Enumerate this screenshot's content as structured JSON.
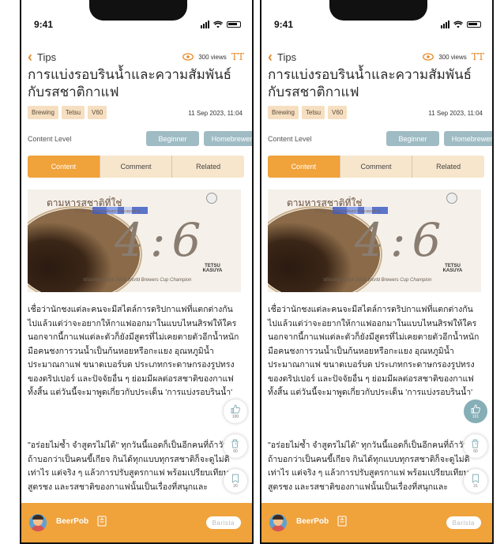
{
  "screens": [
    {
      "status": {
        "time": "9:41"
      },
      "header": {
        "back_label": "Tips",
        "views": "300 views",
        "text_size_icon": "TT"
      },
      "article": {
        "title": "การแบ่งรอบรินน้ำและความสัมพันธ์กับรสชาติกาแฟ",
        "tags": [
          "Brewing",
          "Tetsu",
          "V60"
        ],
        "date": "11 Sep 2023, 11:04",
        "content_level_label": "Content Level",
        "levels": [
          "Beginner",
          "Homebrewer"
        ],
        "tabs": [
          "Content",
          "Comment",
          "Related"
        ],
        "cover": {
          "line1": "ตามหารสชาติที่ใช่",
          "line2": "ปรับสูตรตามความต้องการของคุณด้วย",
          "ratio": "4:6",
          "author": "TETSU KASUYA",
          "footer": "Winning recipe 2016 World Brewers Cup Champion"
        },
        "paragraph1": "เชื่อว่านักชงแต่ละคนจะมีสไตล์การดริปกาแฟที่แตกต่างกันไปแล้วแต่ว่าจะอยากให้กาแฟออกมาในแบบไหนสิรฟให้ใครนอกจากนี้กาแฟแต่ละตัวก็ยังมีสูตรที่ไม่เคยตายตัวอีกน้ำหนักมือคนชงการวนน้ำเป็นก้นหอยหรือกะแยง อุณหภูมิน้ำประมาณกาแฟ ขนาดเบอร์บด ประเภทกระดาษกรองรูปทรงของดริปเปอร์ และปัจจัยอื่น ๆ ย่อมมีผลต่อรสชาติของกาแฟทั้งสิ้น แต่วันนี้จะมาพูดเกี่ยวกับประเด็น 'การแบ่งรอบรินน้ำ'",
        "paragraph2": "\"อร่อยไม่ซ้ำ จำสูตรไม่ได้\" ทุกวันนี้แอดก็เป็นอีกคนที่ถ้าวันนี้ ถ้าบอกว่าเป็นคนขี้เกียจ กินได้ทุกแบบทุกรสชาติก็จะดูไม่ดีเท่าไร แต่จริง ๆ แล้วการปรับสูตรกาแฟ พร้อมเปรียบเทียบสูตรชง และรสชาติของกาแฟนั้นเป็นเรื่องที่สนุกและ"
      },
      "actions": {
        "likes": "100",
        "cups": "60",
        "saves": "20",
        "like_active": false
      },
      "footer": {
        "author": "BeerPob",
        "role": "Barista"
      }
    },
    {
      "status": {
        "time": "9:41"
      },
      "header": {
        "back_label": "Tips",
        "views": "300 views",
        "text_size_icon": "TT"
      },
      "article": {
        "title": "การแบ่งรอบรินน้ำและความสัมพันธ์กับรสชาติกาแฟ",
        "tags": [
          "Brewing",
          "Tetsu",
          "V60"
        ],
        "date": "11 Sep 2023, 11:04",
        "content_level_label": "Content Level",
        "levels": [
          "Beginner",
          "Homebrewer"
        ],
        "tabs": [
          "Content",
          "Comment",
          "Related"
        ],
        "cover": {
          "line1": "ตามหารสชาติที่ใช่",
          "line2": "ปรับสูตรตามความต้องการของคุณด้วย",
          "ratio": "4:6",
          "author": "TETSU KASUYA",
          "footer": "Winning recipe 2016 World Brewers Cup Champion"
        },
        "paragraph1": "เชื่อว่านักชงแต่ละคนจะมีสไตล์การดริปกาแฟที่แตกต่างกันไปแล้วแต่ว่าจะอยากให้กาแฟออกมาในแบบไหนสิรฟให้ใครนอกจากนี้กาแฟแต่ละตัวก็ยังมีสูตรที่ไม่เคยตายตัวอีกน้ำหนักมือคนชงการวนน้ำเป็นก้นหอยหรือกะแยง อุณหภูมิน้ำประมาณกาแฟ ขนาดเบอร์บด ประเภทกระดาษกรองรูปทรงของดริปเปอร์ และปัจจัยอื่น ๆ ย่อมมีผลต่อรสชาติของกาแฟทั้งสิ้น แต่วันนี้จะมาพูดเกี่ยวกับประเด็น 'การแบ่งรอบรินน้ำ'",
        "paragraph2": "\"อร่อยไม่ซ้ำ จำสูตรไม่ได้\" ทุกวันนี้แอดก็เป็นอีกคนที่ถ้าวันนี้ ถ้าบอกว่าเป็นคนขี้เกียจ กินได้ทุกแบบทุกรสชาติก็จะดูไม่ดีเท่าไร แต่จริง ๆ แล้วการปรับสูตรกาแฟ พร้อมเปรียบเทียบสูตรชง และรสชาติของกาแฟนั้นเป็นเรื่องที่สนุกและ"
      },
      "actions": {
        "likes": "101",
        "cups": "60",
        "saves": "21",
        "like_active": true
      },
      "footer": {
        "author": "BeerPob",
        "role": "Barista"
      }
    }
  ],
  "colors": {
    "accent": "#f0a23b",
    "tag_bg": "#f6dfc0",
    "level_btn": "#9fbcc4",
    "active_float": "#86aeb7"
  }
}
